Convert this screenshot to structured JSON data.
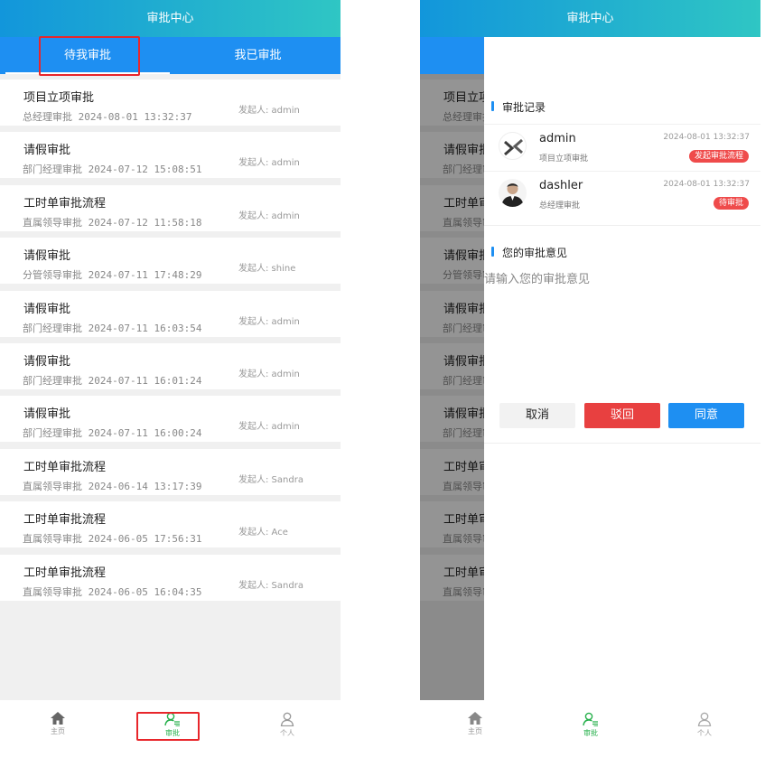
{
  "header": {
    "title": "审批中心"
  },
  "tabs": {
    "pending": "待我审批",
    "done": "我已审批"
  },
  "list": [
    {
      "title": "项目立项审批",
      "sub": "总经理审批 2024-08-01 13:32:37",
      "initiator": "发起人: admin"
    },
    {
      "title": "请假审批",
      "sub": "部门经理审批 2024-07-12 15:08:51",
      "initiator": "发起人: admin"
    },
    {
      "title": "工时单审批流程",
      "sub": "直属领导审批 2024-07-12 11:58:18",
      "initiator": "发起人: admin"
    },
    {
      "title": "请假审批",
      "sub": "分管领导审批 2024-07-11 17:48:29",
      "initiator": "发起人: shine"
    },
    {
      "title": "请假审批",
      "sub": "部门经理审批 2024-07-11 16:03:54",
      "initiator": "发起人: admin"
    },
    {
      "title": "请假审批",
      "sub": "部门经理审批 2024-07-11 16:01:24",
      "initiator": "发起人: admin"
    },
    {
      "title": "请假审批",
      "sub": "部门经理审批 2024-07-11 16:00:24",
      "initiator": "发起人: admin"
    },
    {
      "title": "工时单审批流程",
      "sub": "直属领导审批 2024-06-14 13:17:39",
      "initiator": "发起人: Sandra"
    },
    {
      "title": "工时单审批流程",
      "sub": "直属领导审批 2024-06-05 17:56:31",
      "initiator": "发起人: Ace"
    },
    {
      "title": "工时单审批流程",
      "sub": "直属领导审批 2024-06-05 16:04:35",
      "initiator": "发起人: Sandra"
    }
  ],
  "tabbar": {
    "home": "主页",
    "approve": "审批",
    "me": "个人"
  },
  "drawer": {
    "records_title": "审批记录",
    "records": [
      {
        "name": "admin",
        "step": "项目立项审批",
        "time": "2024-08-01 13:32:37",
        "badge": "发起审批流程"
      },
      {
        "name": "dashler",
        "step": "总经理审批",
        "time": "2024-08-01 13:32:37",
        "badge": "待审批"
      }
    ],
    "opinion_title": "您的审批意见",
    "opinion_placeholder": "请输入您的审批意见",
    "buttons": {
      "cancel": "取消",
      "reject": "驳回",
      "agree": "同意"
    }
  },
  "colors": {
    "primary": "#1e8ff2",
    "active_tab": "#26b04b",
    "danger": "#e84040",
    "highlight": "#e8262b"
  },
  "icons": {
    "home": "home-icon",
    "approve": "approve-icon",
    "me": "user-icon"
  }
}
